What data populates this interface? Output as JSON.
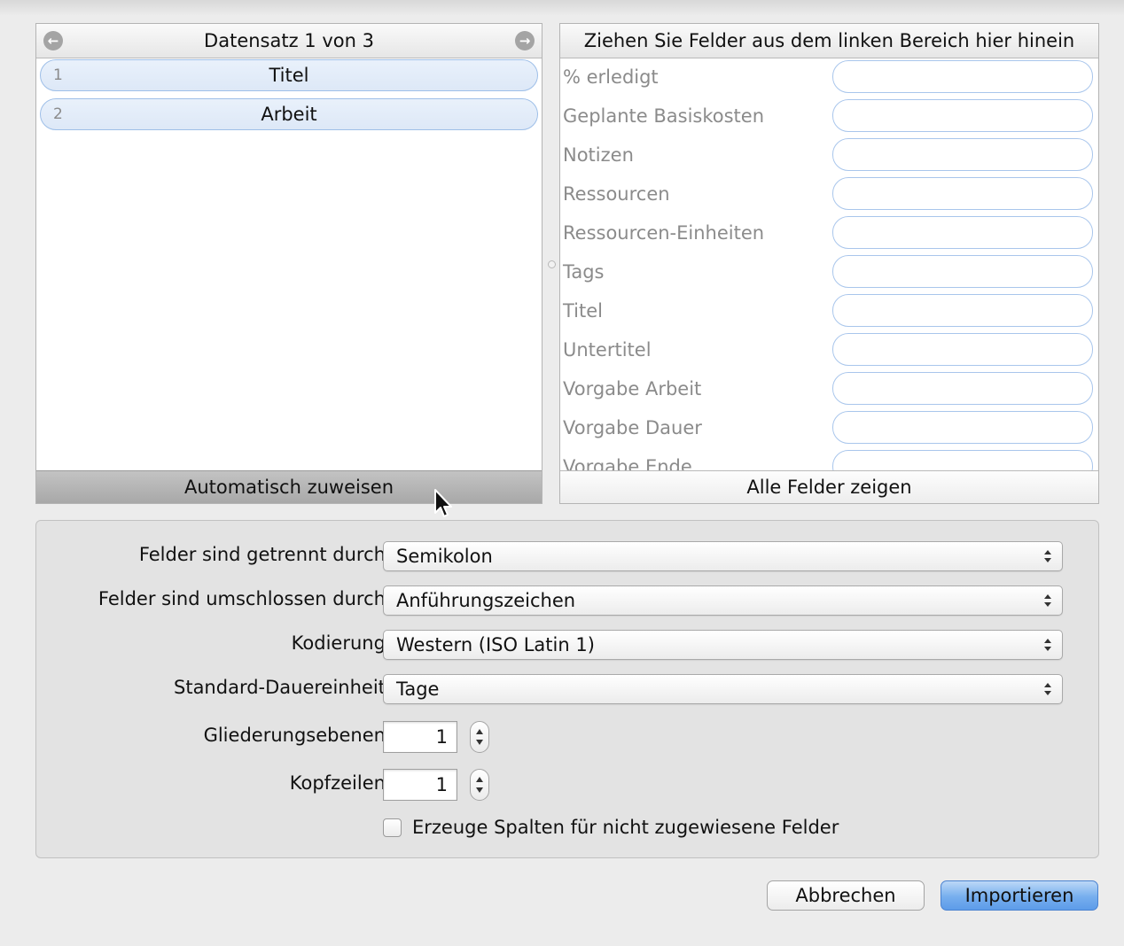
{
  "left_pane": {
    "header": "Datensatz 1 von 3",
    "prev_icon": "arrow-left-circle-icon",
    "next_icon": "arrow-right-circle-icon",
    "fields": [
      {
        "index": "1",
        "label": "Titel"
      },
      {
        "index": "2",
        "label": "Arbeit"
      }
    ],
    "footer_button": "Automatisch zuweisen"
  },
  "right_pane": {
    "header": "Ziehen Sie Felder aus dem linken Bereich hier hinein",
    "targets": [
      "% erledigt",
      "Geplante Basiskosten",
      "Notizen",
      "Ressourcen",
      "Ressourcen-Einheiten",
      "Tags",
      "Titel",
      "Untertitel",
      "Vorgabe Arbeit",
      "Vorgabe Dauer",
      "Vorgabe Ende"
    ],
    "footer_button": "Alle Felder zeigen"
  },
  "options": {
    "separator_label": "Felder sind getrennt durch:",
    "separator_value": "Semikolon",
    "enclosure_label": "Felder sind umschlossen durch:",
    "enclosure_value": "Anführungszeichen",
    "encoding_label": "Kodierung:",
    "encoding_value": "Western (ISO Latin 1)",
    "duration_label": "Standard-Dauereinheit:",
    "duration_value": "Tage",
    "outline_label": "Gliederungsebenen:",
    "outline_value": "1",
    "header_rows_label": "Kopfzeilen:",
    "header_rows_value": "1",
    "create_columns_label": "Erzeuge Spalten für nicht zugewiesene Felder"
  },
  "buttons": {
    "cancel": "Abbrechen",
    "import": "Importieren"
  },
  "colors": {
    "pill_border": "#9ebfe8",
    "pill_fill": "#e3ecf9",
    "primary_button": "#6aa6ec"
  }
}
